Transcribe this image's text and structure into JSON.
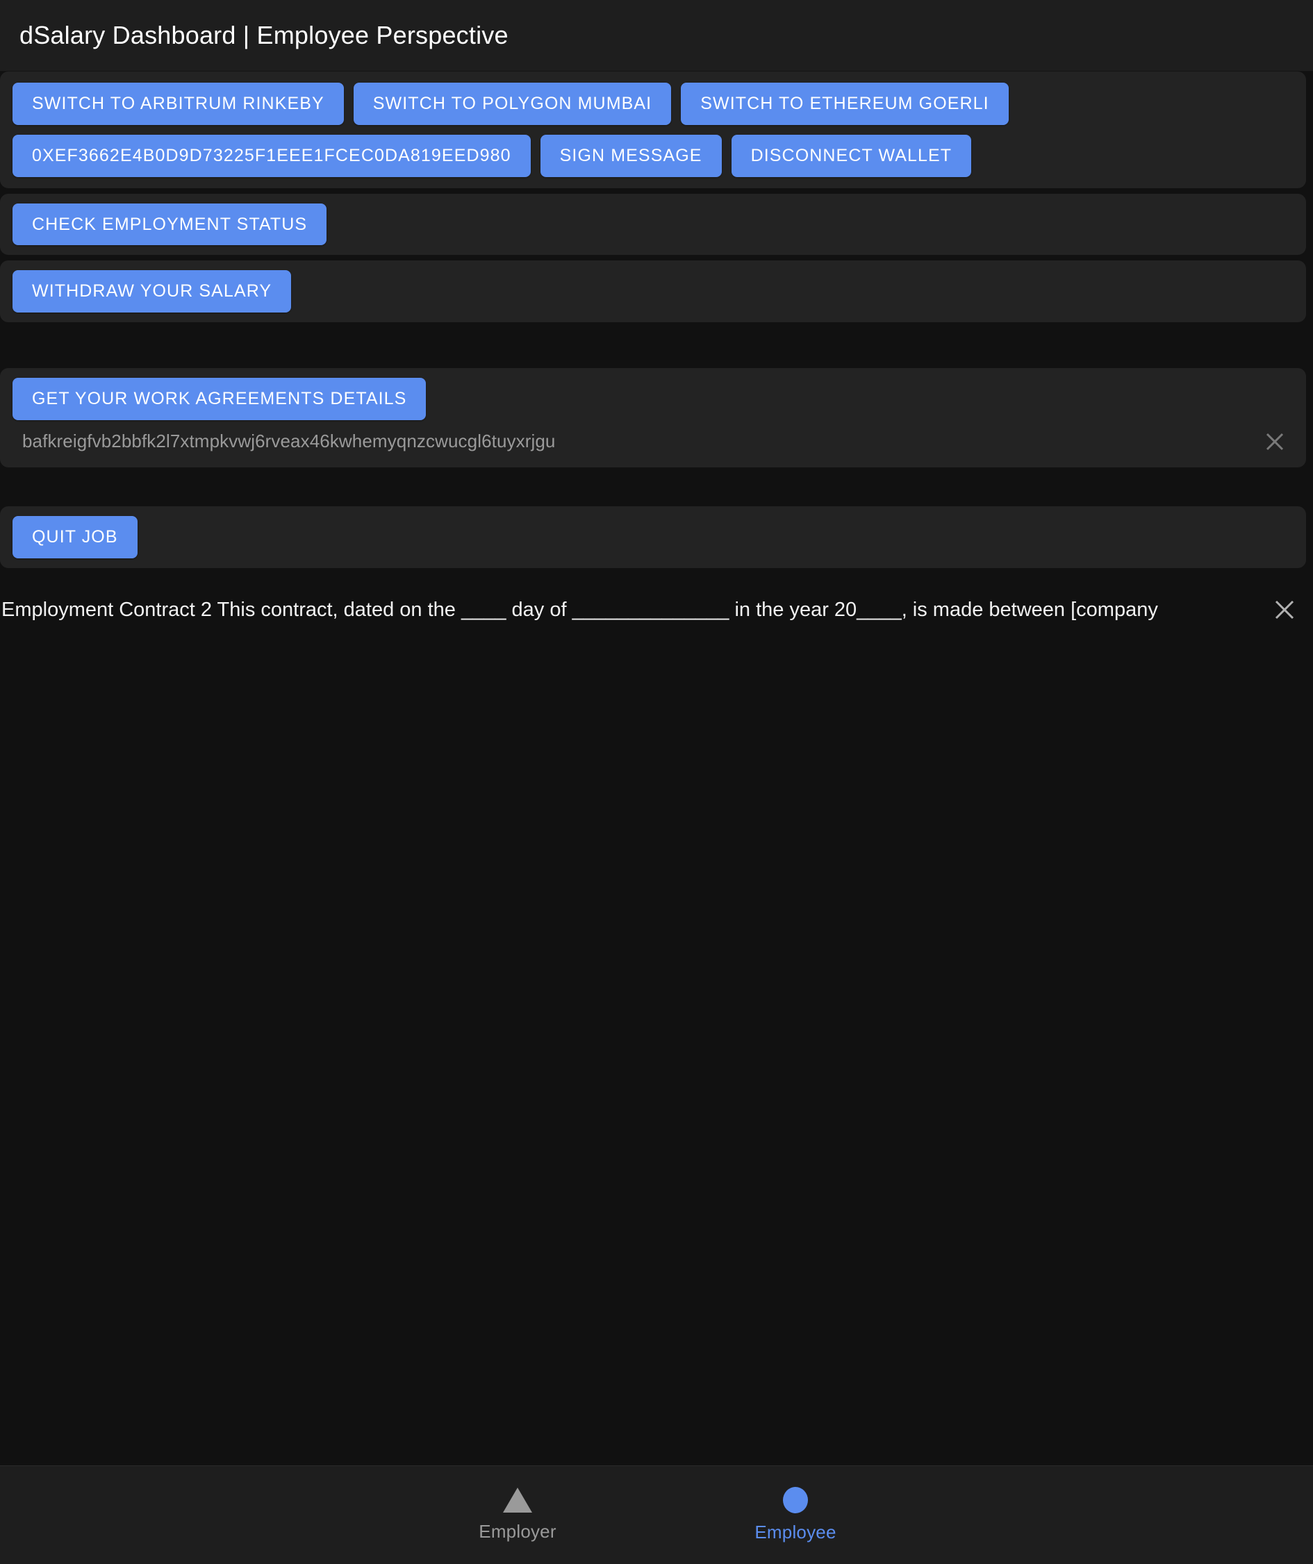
{
  "header": {
    "title": "dSalary Dashboard | Employee Perspective"
  },
  "colors": {
    "accent": "#5b8def",
    "page_background": "#111111",
    "card_background": "#232323",
    "header_background": "#1e1e1e",
    "primary_text": "#ffffff",
    "muted_text": "#9a9a9a"
  },
  "network_section": {
    "buttons": [
      {
        "label": "SWITCH TO ARBITRUM RINKEBY"
      },
      {
        "label": "SWITCH TO POLYGON MUMBAI"
      },
      {
        "label": "SWITCH TO ETHEREUM GOERLI"
      }
    ]
  },
  "wallet_section": {
    "address_label": "0XEF3662E4B0D9D73225F1EEE1FCEC0DA819EED980",
    "sign_label": "SIGN MESSAGE",
    "disconnect_label": "DISCONNECT WALLET"
  },
  "status_section": {
    "check_label": "CHECK EMPLOYMENT STATUS"
  },
  "withdraw_section": {
    "withdraw_label": "WITHDRAW YOUR SALARY"
  },
  "agreements_section": {
    "get_details_label": "GET YOUR WORK AGREEMENTS DETAILS",
    "hash": "bafkreigfvb2bbfk2l7xtmpkvwj6rveax46kwhemyqnzcwucgl6tuyxrjgu",
    "dismiss_icon": "close-icon"
  },
  "quit_section": {
    "quit_label": "QUIT JOB"
  },
  "contract_notice": {
    "text": "Employment Contract 2  This contract, dated on the ____ day of ______________ in the year 20____, is made between [company",
    "dismiss_icon": "close-icon"
  },
  "bottom_nav": {
    "items": [
      {
        "label": "Employer",
        "icon": "triangle-icon",
        "active": false
      },
      {
        "label": "Employee",
        "icon": "circle-icon",
        "active": true
      }
    ]
  }
}
